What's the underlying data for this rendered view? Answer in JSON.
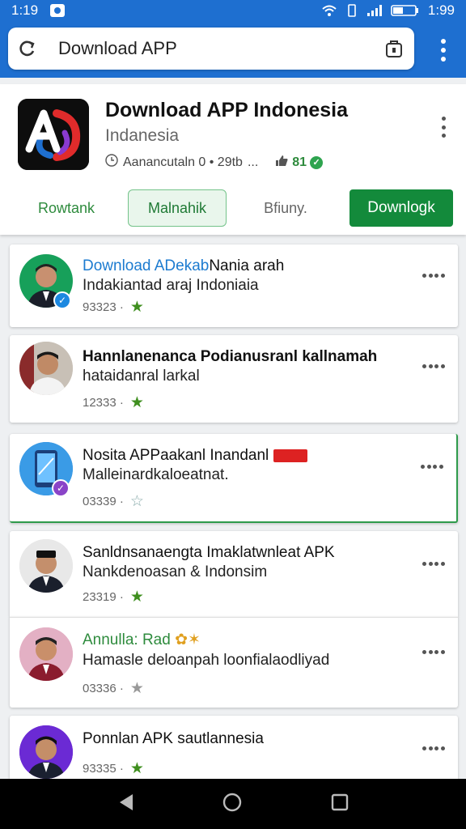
{
  "status_bar": {
    "time_left": "1:19",
    "time_right": "1:99"
  },
  "browser": {
    "url_text": "Download APP"
  },
  "app": {
    "title": "Download APP Indonesia",
    "subtitle": "Indanesia",
    "meta_text": "Aanancutaln 0 • 29tb",
    "meta_dots": "...",
    "rating": "81",
    "tabs": [
      "Rowtank",
      "Malnahik",
      "Bfiuny.",
      "Downlogk"
    ]
  },
  "items": [
    {
      "title_accent": "Download ADekab",
      "title_rest": "Nania arah",
      "line2": "Indakiantad araj Indoniaia",
      "meta": "93323 ·"
    },
    {
      "title_accent": "",
      "title_rest": "Hannlanenanca Podianusranl kallnamah",
      "line2": "hataidanral larkal",
      "meta": "12333 ·"
    },
    {
      "title_accent": "",
      "title_rest": "Nosita APPaakanl Inandanl",
      "line2": "Malleinardkaloeatnat.",
      "meta": "03339 ·"
    },
    {
      "title_accent": "",
      "title_rest": "Sanldnsanaengta Imaklatwnleat APK",
      "line2": "Nankdenoasan & Indonsim",
      "meta": "23319 ·"
    },
    {
      "title_accent": "Annulla: Rad",
      "title_rest": "",
      "line2": "Hamasle deloanpah loonfialaodliyad",
      "meta": "03336 ·"
    },
    {
      "title_accent": "",
      "title_rest": "Ponnlan APK sautlannesia",
      "line2": "",
      "meta": "93335 ·"
    }
  ],
  "colors": {
    "accent_blue": "#1e6fd0",
    "accent_green": "#138a3b",
    "star_green": "#3f8f1f"
  }
}
